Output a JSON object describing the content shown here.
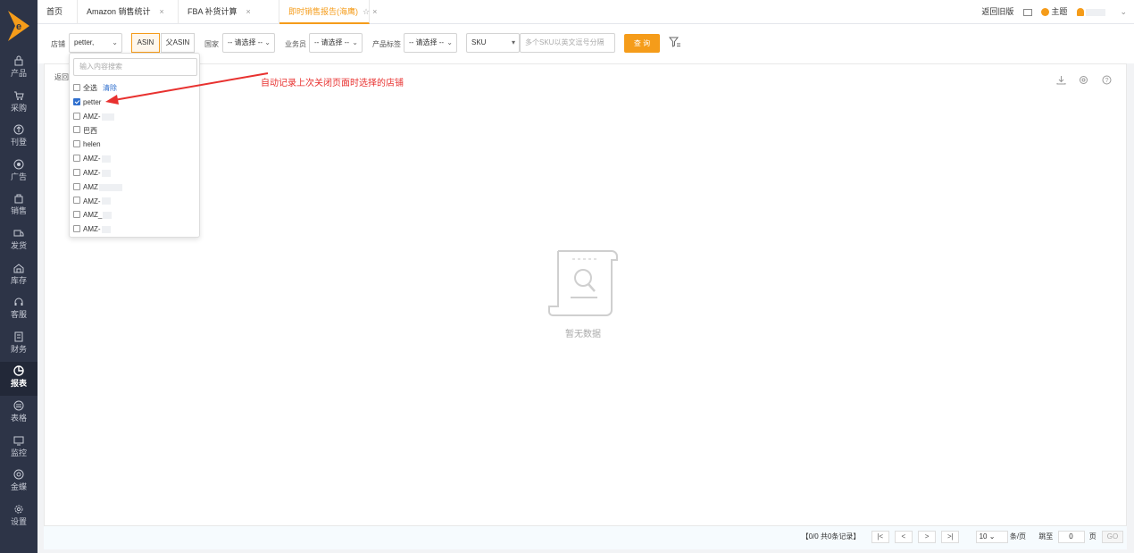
{
  "sidebar": {
    "items": [
      {
        "label": "产品",
        "icon": "lock-icon"
      },
      {
        "label": "采购",
        "icon": "cart-icon"
      },
      {
        "label": "刊登",
        "icon": "upload-icon"
      },
      {
        "label": "广告",
        "icon": "megaphone-icon"
      },
      {
        "label": "销售",
        "icon": "bag-icon"
      },
      {
        "label": "发货",
        "icon": "truck-icon"
      },
      {
        "label": "库存",
        "icon": "warehouse-icon"
      },
      {
        "label": "客服",
        "icon": "headset-icon"
      },
      {
        "label": "财务",
        "icon": "ledger-icon"
      },
      {
        "label": "报表",
        "icon": "piechart-icon",
        "active": true
      },
      {
        "label": "表格",
        "icon": "table-icon"
      },
      {
        "label": "监控",
        "icon": "monitor-icon"
      },
      {
        "label": "金蝶",
        "icon": "coin-icon"
      },
      {
        "label": "设置",
        "icon": "gear-icon"
      }
    ]
  },
  "tabs": [
    {
      "label": "首页"
    },
    {
      "label": "Amazon 销售统计",
      "close": "×"
    },
    {
      "label": "FBA 补货计算",
      "close": "×"
    },
    {
      "label": "即时销售报告(海鹰)",
      "star": "☆",
      "close": "×",
      "active": true
    }
  ],
  "topbar": {
    "old_version": "返回旧版",
    "theme": "主题",
    "user": "",
    "chevron": "⌄"
  },
  "filters": {
    "store_label": "店铺",
    "store_value": "petter,",
    "asin_label": "ASIN",
    "parent_asin_label": "父ASIN",
    "country_label": "国家",
    "country_value": "-- 请选择 --",
    "salesperson_label": "业务员",
    "salesperson_value": "-- 请选择 --",
    "product_tag_label": "产品标签",
    "product_tag_value": "-- 请选择 --",
    "sku_type_value": "SKU",
    "sku_placeholder": "多个SKU以英文逗号分隔",
    "query_button": "查 询"
  },
  "dropdown": {
    "search_placeholder": "输入内容搜索",
    "select_all": "全选",
    "clear": "清除",
    "options": [
      {
        "label": "petter",
        "checked": true
      },
      {
        "label": "AMZ-",
        "checked": false
      },
      {
        "label": "巴西",
        "checked": false
      },
      {
        "label": "helen",
        "checked": false
      },
      {
        "label": "AMZ-",
        "checked": false
      },
      {
        "label": "AMZ-",
        "checked": false
      },
      {
        "label": "AMZ",
        "checked": false
      },
      {
        "label": "AMZ-",
        "checked": false
      },
      {
        "label": "AMZ_",
        "checked": false
      },
      {
        "label": "AMZ-",
        "checked": false
      }
    ]
  },
  "panel": {
    "back_label": "返回",
    "empty_text": "暂无数据"
  },
  "annotation": {
    "text": "自动记录上次关闭页面时选择的店铺",
    "color": "#e8312f"
  },
  "pagination": {
    "summary": "【0/0  共0条记录】",
    "first": "|<",
    "prev": "<",
    "next": ">",
    "last": ">|",
    "page_size": "10",
    "per_page": "条/页",
    "goto_label": "跳至",
    "page_value": "0",
    "page_unit": "页",
    "go": "GO"
  },
  "colors": {
    "accent": "#f59c1a",
    "sidebar": "#2d3447",
    "link": "#2f6fce"
  }
}
